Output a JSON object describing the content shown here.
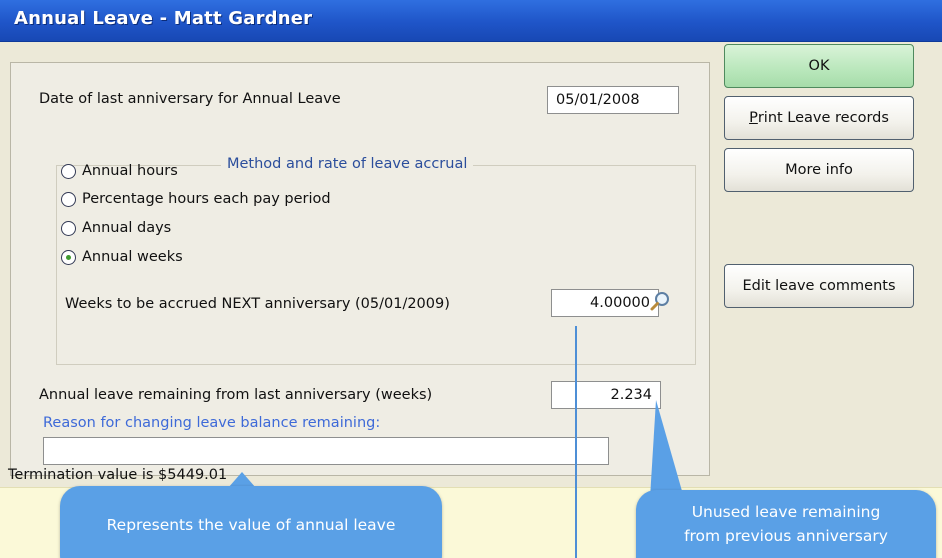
{
  "window": {
    "title": "Annual Leave - Matt Gardner"
  },
  "form": {
    "anniversary_label": "Date of last anniversary for Annual Leave",
    "anniversary_value": "05/01/2008",
    "method_group_title": "Method and rate of leave accrual",
    "methods": [
      {
        "label": "Annual hours",
        "checked": false
      },
      {
        "label": "Percentage hours each pay period",
        "checked": false
      },
      {
        "label": "Annual days",
        "checked": false
      },
      {
        "label": "Annual weeks",
        "checked": true
      }
    ],
    "weeks_label": "Weeks to be accrued NEXT anniversary (05/01/2009)",
    "weeks_value": "4.00000",
    "remaining_label": "Annual leave remaining from last anniversary (weeks)",
    "remaining_value": "2.234",
    "reason_label": "Reason for changing leave balance remaining:",
    "reason_value": ""
  },
  "buttons": {
    "ok": "OK",
    "print_first": "P",
    "print_rest": "rint Leave records",
    "more_info": "More info",
    "edit_comments": "Edit leave comments"
  },
  "footer": {
    "termination": "Termination value is $5449.01"
  },
  "callouts": {
    "left": "Represents the value of annual leave",
    "right_line1": "Unused leave remaining",
    "right_line2": "from previous anniversary"
  },
  "colors": {
    "title_bar": "#1f55c8",
    "dialog_bg": "#ece9d8",
    "ok_button": "#b9e7bb",
    "footer_bg": "#fbf9d8",
    "callout": "#5aa0e6",
    "group_legend": "#2b4e9c",
    "reason_label": "#3e6ad8"
  },
  "icons": {
    "lookup": "magnifier-icon"
  }
}
